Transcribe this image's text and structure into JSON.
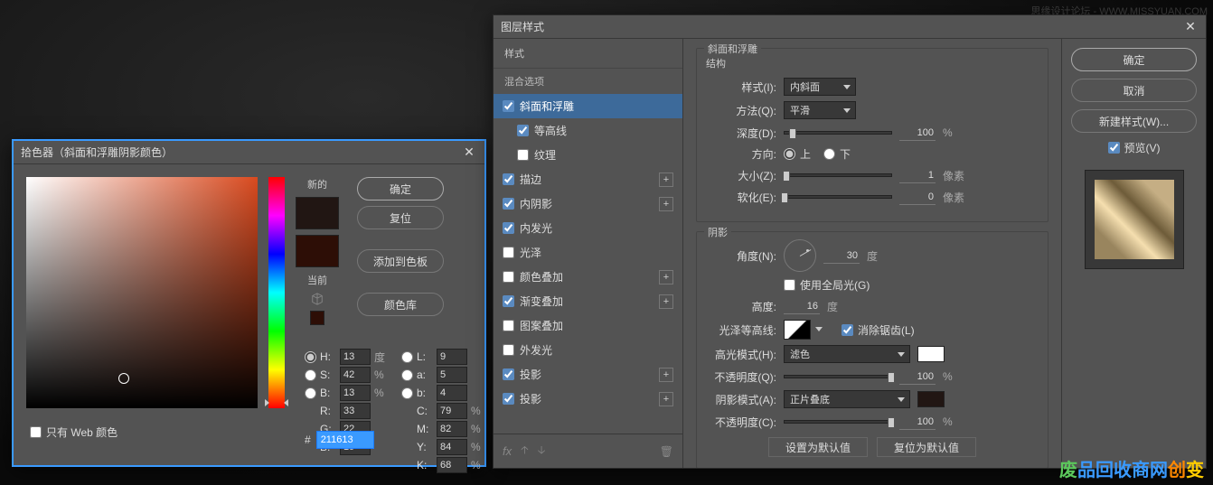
{
  "watermark_top": "思缘设计论坛 - WWW.MISSYUAN.COM",
  "watermark_bottom": "废品回收商网创变",
  "colorPicker": {
    "title": "拾色器（斜面和浮雕阴影颜色）",
    "new_label": "新的",
    "current_label": "当前",
    "btn_ok": "确定",
    "btn_reset": "复位",
    "btn_add": "添加到色板",
    "btn_lib": "颜色库",
    "web_only": "只有 Web 颜色",
    "hex_label": "#",
    "hex": "211613",
    "H": {
      "l": "H:",
      "v": "13",
      "u": "度"
    },
    "S": {
      "l": "S:",
      "v": "42",
      "u": "%"
    },
    "B": {
      "l": "B:",
      "v": "13",
      "u": "%"
    },
    "R": {
      "l": "R:",
      "v": "33"
    },
    "G": {
      "l": "G:",
      "v": "22"
    },
    "Bb": {
      "l": "B:",
      "v": "19"
    },
    "L": {
      "l": "L:",
      "v": "9"
    },
    "a": {
      "l": "a:",
      "v": "5"
    },
    "b": {
      "l": "b:",
      "v": "4"
    },
    "C": {
      "l": "C:",
      "v": "79",
      "u": "%"
    },
    "M": {
      "l": "M:",
      "v": "82",
      "u": "%"
    },
    "Y": {
      "l": "Y:",
      "v": "84",
      "u": "%"
    },
    "K": {
      "l": "K:",
      "v": "68",
      "u": "%"
    }
  },
  "layerStyle": {
    "title": "图层样式",
    "styles_header": "样式",
    "blend_opts": "混合选项",
    "items": [
      {
        "label": "斜面和浮雕",
        "checked": true,
        "active": true
      },
      {
        "label": "等高线",
        "checked": true,
        "indent": true
      },
      {
        "label": "纹理",
        "checked": false,
        "indent": true
      },
      {
        "label": "描边",
        "checked": true,
        "plus": true
      },
      {
        "label": "内阴影",
        "checked": true,
        "plus": true
      },
      {
        "label": "内发光",
        "checked": true
      },
      {
        "label": "光泽",
        "checked": false
      },
      {
        "label": "颜色叠加",
        "checked": false,
        "plus": true
      },
      {
        "label": "渐变叠加",
        "checked": true,
        "plus": true
      },
      {
        "label": "图案叠加",
        "checked": false
      },
      {
        "label": "外发光",
        "checked": false
      },
      {
        "label": "投影",
        "checked": true,
        "plus": true
      },
      {
        "label": "投影",
        "checked": true,
        "plus": true
      }
    ],
    "fx": "fx",
    "panel_title": "斜面和浮雕",
    "structure": "结构",
    "style_l": "样式(I):",
    "style_v": "内斜面",
    "tech_l": "方法(Q):",
    "tech_v": "平滑",
    "depth_l": "深度(D):",
    "depth_v": "100",
    "depth_u": "%",
    "dir_l": "方向:",
    "dir_up": "上",
    "dir_down": "下",
    "size_l": "大小(Z):",
    "size_v": "1",
    "size_u": "像素",
    "soften_l": "软化(E):",
    "soften_v": "0",
    "soften_u": "像素",
    "shading": "阴影",
    "angle_l": "角度(N):",
    "angle_v": "30",
    "angle_u": "度",
    "global": "使用全局光(G)",
    "alt_l": "高度:",
    "alt_v": "16",
    "alt_u": "度",
    "gloss_l": "光泽等高线:",
    "anti": "消除锯齿(L)",
    "hl_mode_l": "高光模式(H):",
    "hl_mode_v": "滤色",
    "hl_op_l": "不透明度(Q):",
    "hl_op_v": "100",
    "hl_op_u": "%",
    "sh_mode_l": "阴影模式(A):",
    "sh_mode_v": "正片叠底",
    "sh_op_l": "不透明度(C):",
    "sh_op_v": "100",
    "sh_op_u": "%",
    "btn_default": "设置为默认值",
    "btn_reset_default": "复位为默认值",
    "btn_ok": "确定",
    "btn_cancel": "取消",
    "btn_new": "新建样式(W)...",
    "preview": "预览(V)"
  }
}
